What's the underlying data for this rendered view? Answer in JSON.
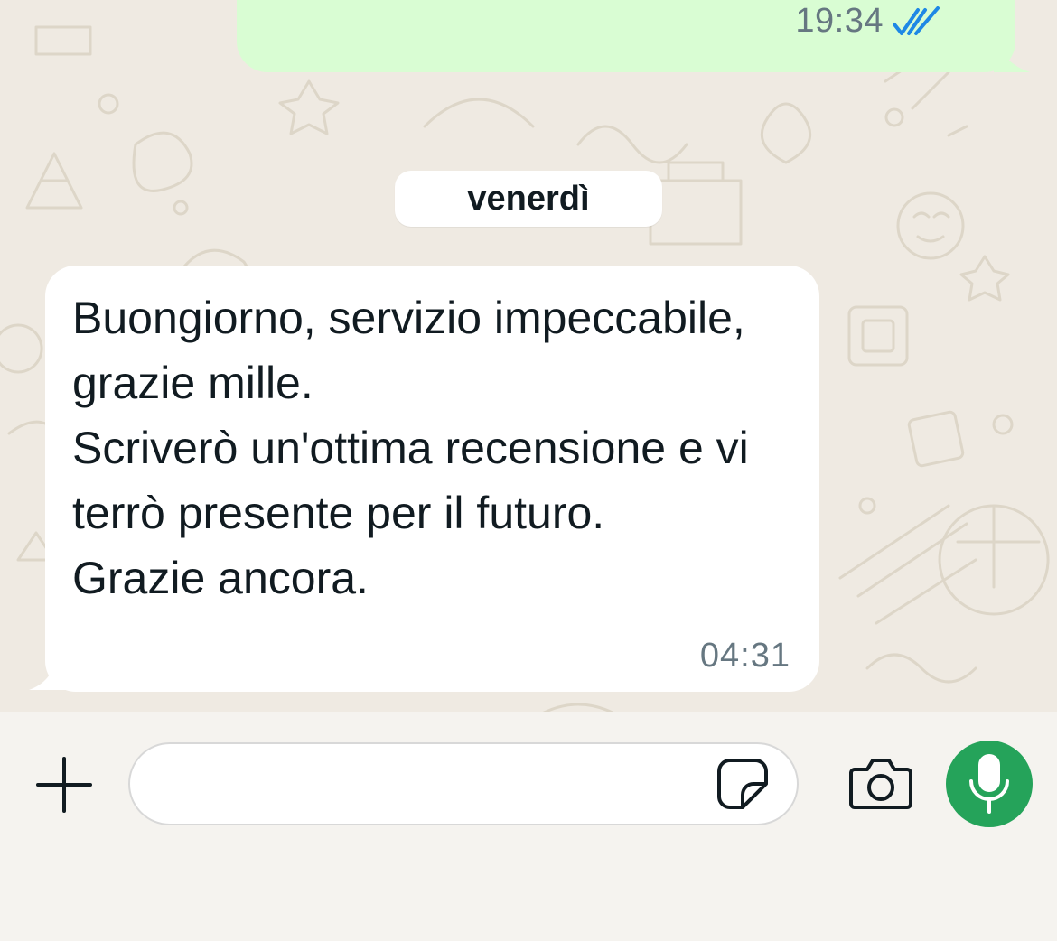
{
  "colors": {
    "chat_background": "#efeae2",
    "outgoing_bubble": "#d9fdd3",
    "incoming_bubble": "#ffffff",
    "read_ticks": "#1e88e5",
    "mic_button": "#25a35a",
    "timestamp": "#667781"
  },
  "outgoing_message": {
    "time": "19:34",
    "status_icon": "double-check-read-icon"
  },
  "date_separator": {
    "label": "venerdì"
  },
  "incoming_message": {
    "text": "Buongiorno, servizio impeccabile, grazie mille.\nScriverò un'ottima recensione e vi terrò presente per il futuro.\nGrazie ancora.",
    "time": "04:31"
  },
  "composer": {
    "input_value": "",
    "input_placeholder": "",
    "icons": [
      "plus-icon",
      "sticker-icon",
      "camera-icon",
      "microphone-icon"
    ]
  }
}
